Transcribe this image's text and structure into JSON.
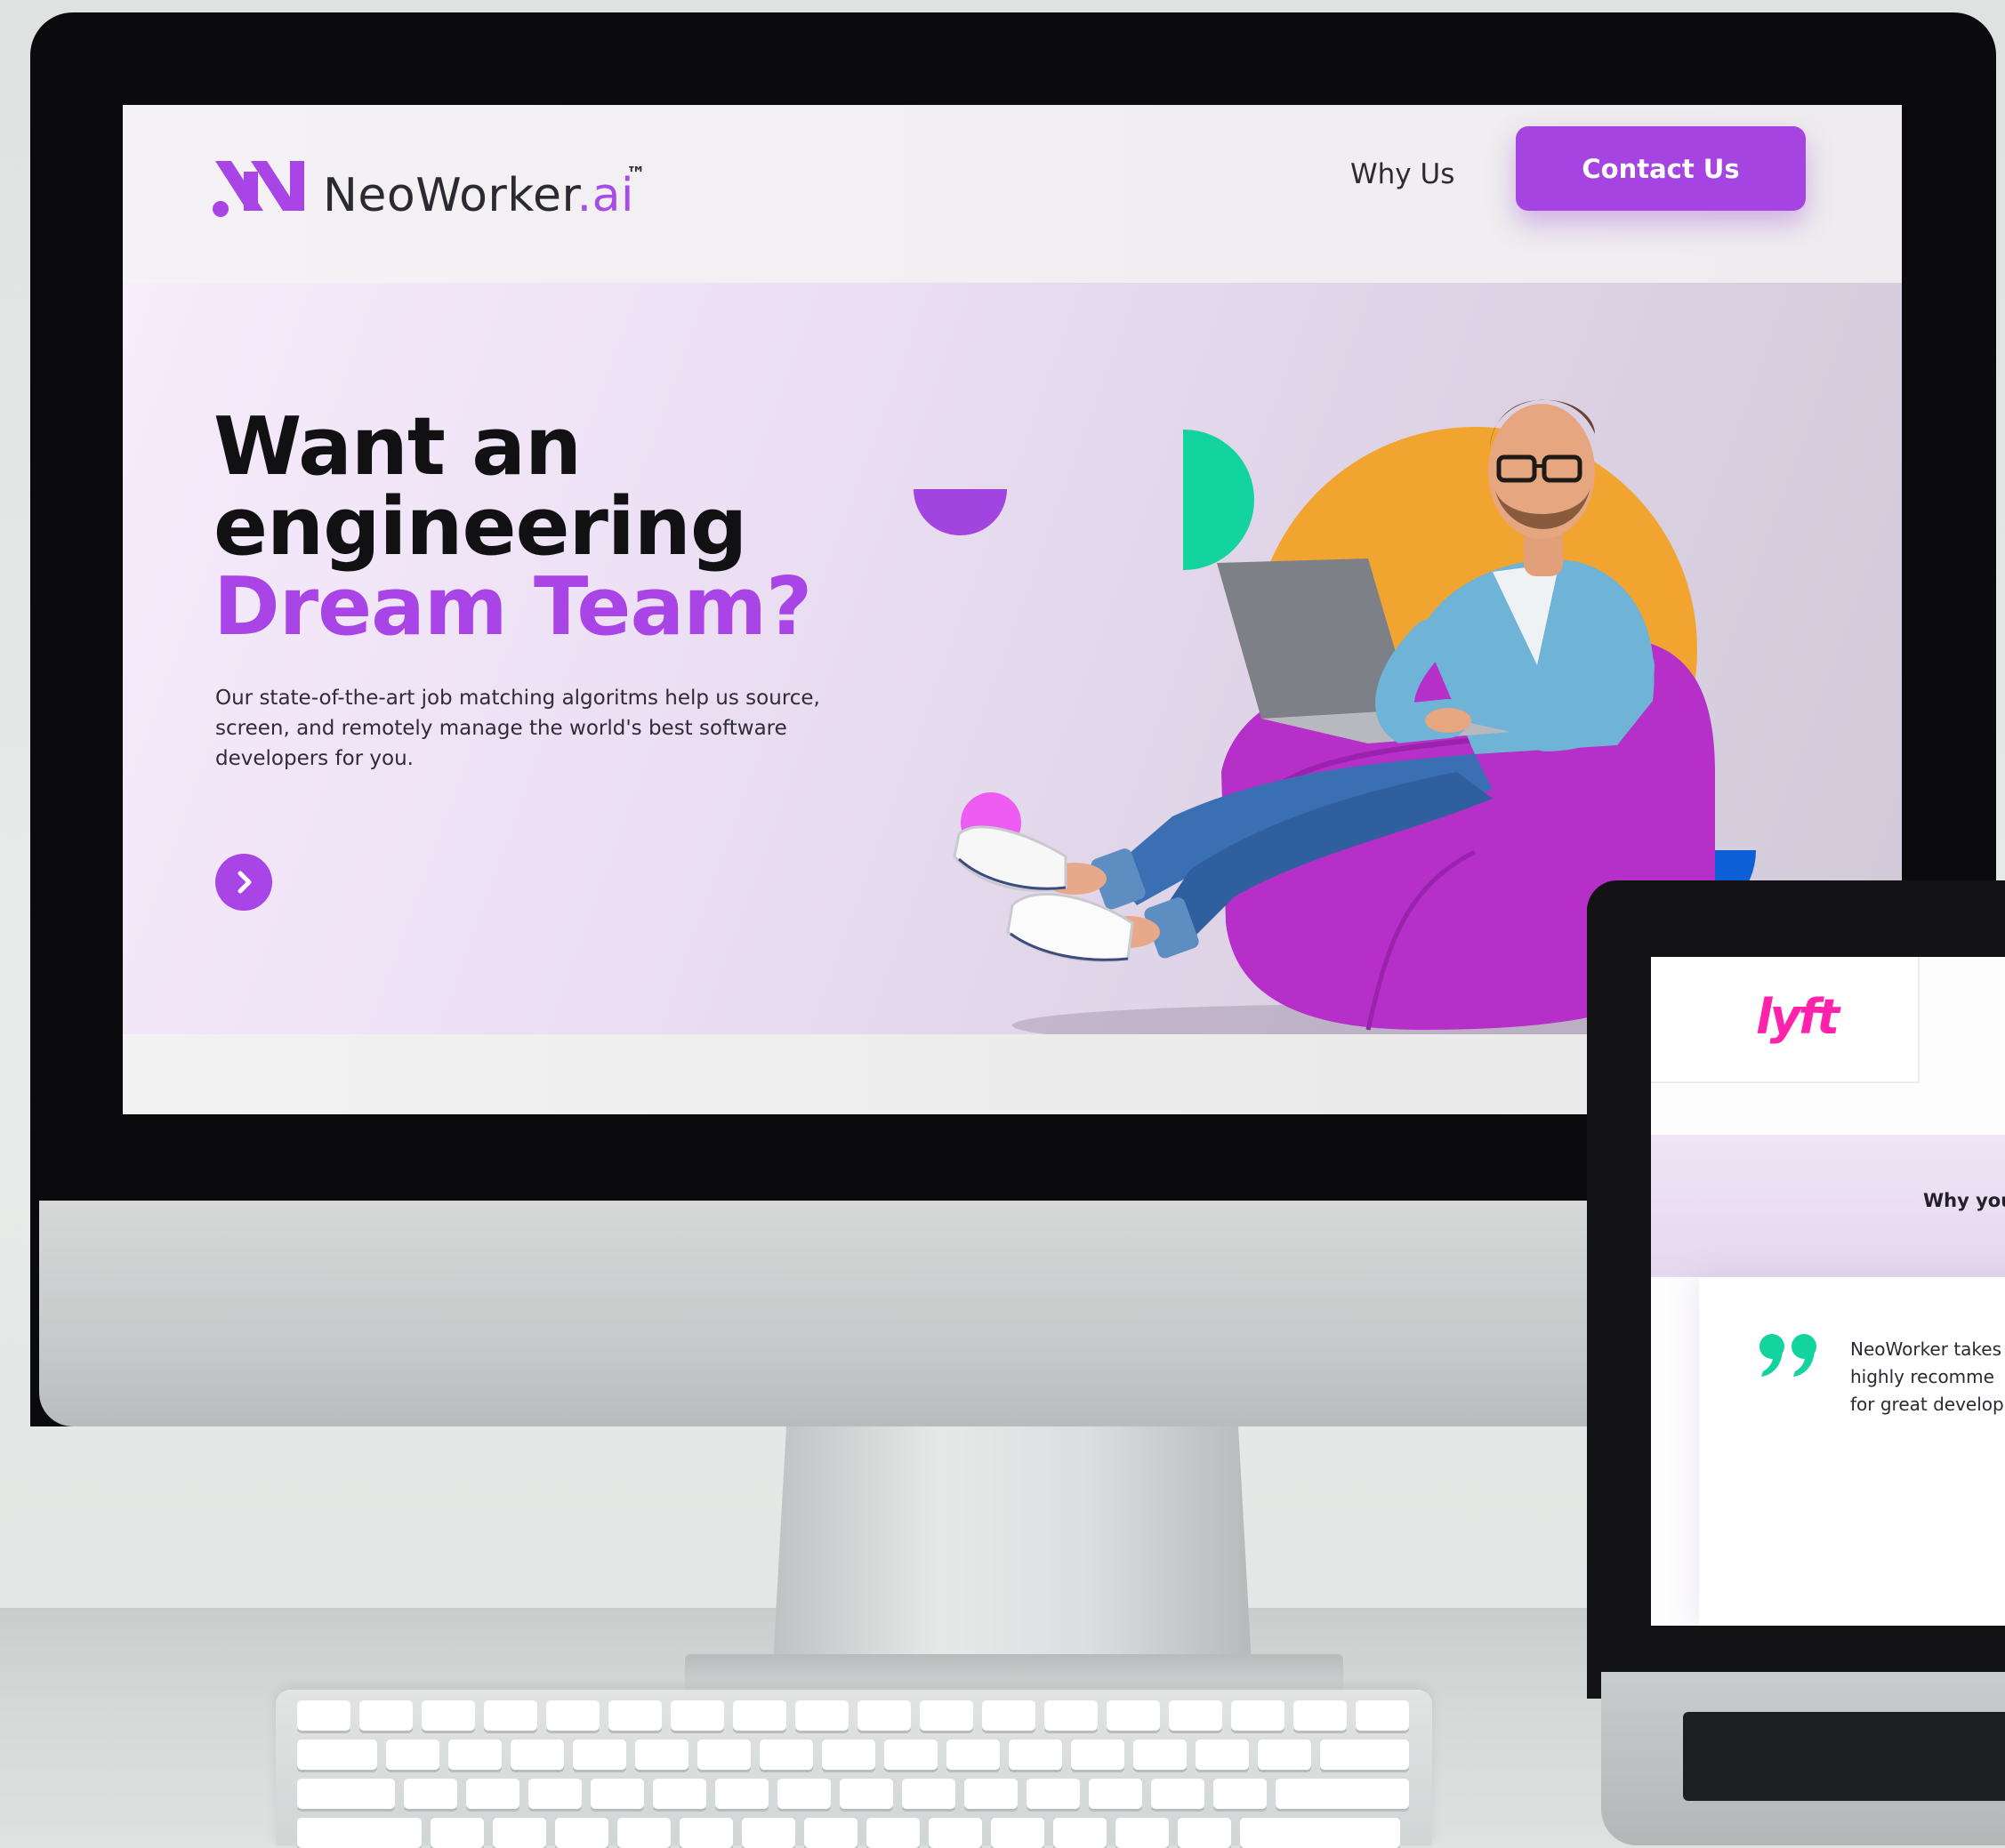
{
  "colors": {
    "brand_purple": "#a944e6",
    "dark_text": "#111114",
    "accent_green": "#13d39f",
    "accent_orange": "#f1a530",
    "accent_pink": "#ef5cf2",
    "accent_blue": "#0d5fd6",
    "lyft_pink": "#ff22aa"
  },
  "header": {
    "logo": {
      "name": "NeoWorker",
      "tld": ".ai",
      "trademark": "™"
    },
    "nav": {
      "why_us": "Why Us",
      "contact": "Contact Us"
    }
  },
  "hero": {
    "title_line1": "Want an",
    "title_line2": "engineering",
    "title_line3": "Dream Team?",
    "lead": "Our state-of-the-art job matching algoritms help us source, screen, and remotely manage the world's best software developers for you.",
    "next_icon": "chevron-right-icon"
  },
  "laptop": {
    "client_logo": "lyft",
    "why_heading": "Why you",
    "testimonial_icon": "quote-icon",
    "testimonial_lines": [
      "NeoWorker takes",
      "highly recomme",
      "for great develop"
    ]
  }
}
